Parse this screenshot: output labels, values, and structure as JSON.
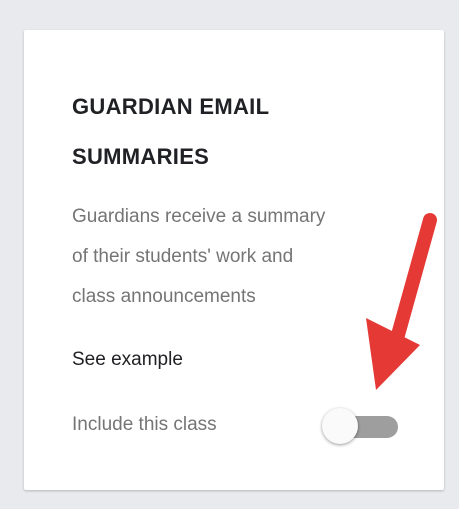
{
  "card": {
    "title_line1": "GUARDIAN EMAIL",
    "title_line2": "SUMMARIES",
    "description_line1": "Guardians receive a summary",
    "description_line2": "of their students' work and",
    "description_line3": "class announcements",
    "example_link": "See example",
    "toggle_label": "Include this class",
    "toggle_on": false
  },
  "annotation": {
    "arrow_icon": "red-arrow-pointing-down-left",
    "color": "#e53935"
  }
}
